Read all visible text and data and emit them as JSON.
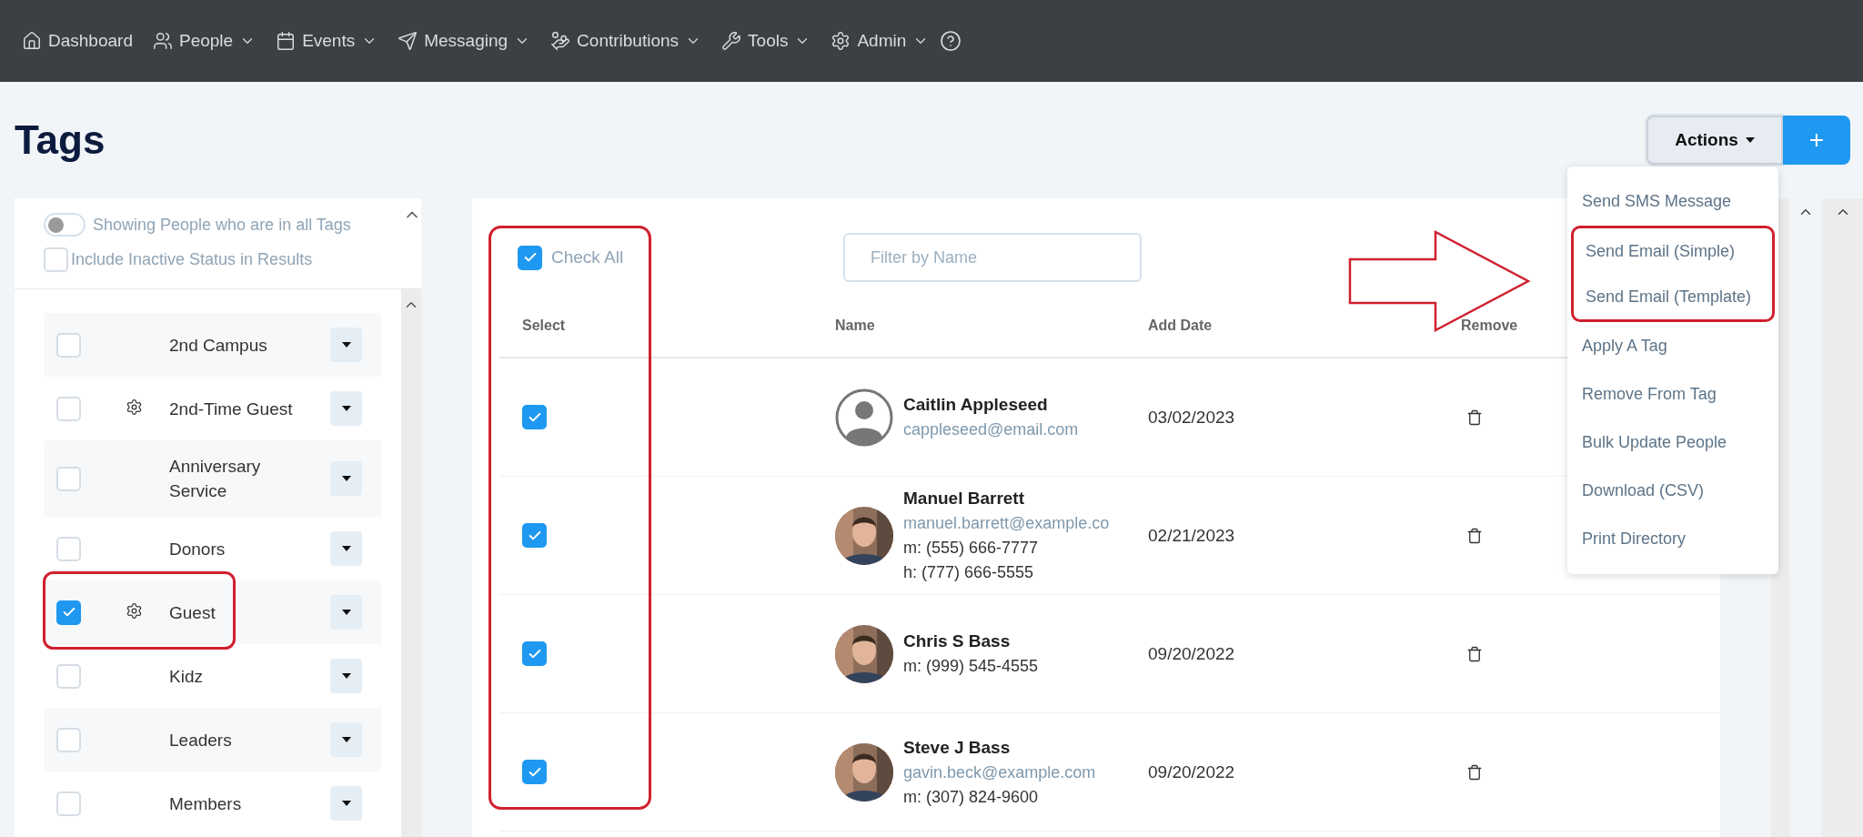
{
  "nav": {
    "items": [
      {
        "label": "Dashboard",
        "has_menu": false
      },
      {
        "label": "People",
        "has_menu": true
      },
      {
        "label": "Events",
        "has_menu": true
      },
      {
        "label": "Messaging",
        "has_menu": true
      },
      {
        "label": "Contributions",
        "has_menu": true
      },
      {
        "label": "Tools",
        "has_menu": true
      },
      {
        "label": "Admin",
        "has_menu": true
      }
    ]
  },
  "page_title": "Tags",
  "actions": {
    "label": "Actions",
    "add_label": "+",
    "expanded": true,
    "menu": [
      "Send SMS Message",
      "Send Email (Simple)",
      "Send Email (Template)",
      "Apply A Tag",
      "Remove From Tag",
      "Bulk Update People",
      "Download (CSV)",
      "Print Directory"
    ]
  },
  "options": {
    "toggle": {
      "label": "Showing People who are in all Tags",
      "on": false
    },
    "inactive": {
      "label": "Include Inactive Status in Results",
      "checked": false
    }
  },
  "tags": [
    {
      "label": "2nd Campus",
      "checked": false,
      "has_settings": false
    },
    {
      "label": "2nd-Time Guest",
      "checked": false,
      "has_settings": true
    },
    {
      "label": "Anniversary Service",
      "checked": false,
      "has_settings": false
    },
    {
      "label": "Donors",
      "checked": false,
      "has_settings": false
    },
    {
      "label": "Guest",
      "checked": true,
      "has_settings": true
    },
    {
      "label": "Kidz",
      "checked": false,
      "has_settings": false
    },
    {
      "label": "Leaders",
      "checked": false,
      "has_settings": false
    },
    {
      "label": "Members",
      "checked": false,
      "has_settings": false
    }
  ],
  "check_all": {
    "label": "Check All",
    "checked": true
  },
  "filter": {
    "placeholder": "Filter by Name"
  },
  "table": {
    "columns": [
      "Select",
      "Name",
      "Add Date",
      "Remove"
    ],
    "rows": [
      {
        "checked": true,
        "avatar": {
          "kind": "silhouette"
        },
        "name": "Caitlin Appleseed",
        "lines": [
          {
            "kind": "email",
            "text": "cappleseed@email.com"
          }
        ],
        "add_date": "03/02/2023"
      },
      {
        "checked": true,
        "avatar": {
          "kind": "picture"
        },
        "name": "Manuel Barrett",
        "lines": [
          {
            "kind": "email",
            "text": "manuel.barrett@example.co"
          },
          {
            "kind": "phone",
            "text": "m: (555) 666-7777"
          },
          {
            "kind": "phone",
            "text": "h: (777) 666-5555"
          }
        ],
        "add_date": "02/21/2023"
      },
      {
        "checked": true,
        "avatar": {
          "kind": "picture"
        },
        "name": "Chris S Bass",
        "lines": [
          {
            "kind": "phone",
            "text": "m: (999) 545-4555"
          }
        ],
        "add_date": "09/20/2022"
      },
      {
        "checked": true,
        "avatar": {
          "kind": "picture"
        },
        "name": "Steve J Bass",
        "lines": [
          {
            "kind": "email",
            "text": "gavin.beck@example.com"
          },
          {
            "kind": "phone",
            "text": "m: (307) 824-9600"
          }
        ],
        "add_date": "09/20/2022"
      }
    ]
  }
}
